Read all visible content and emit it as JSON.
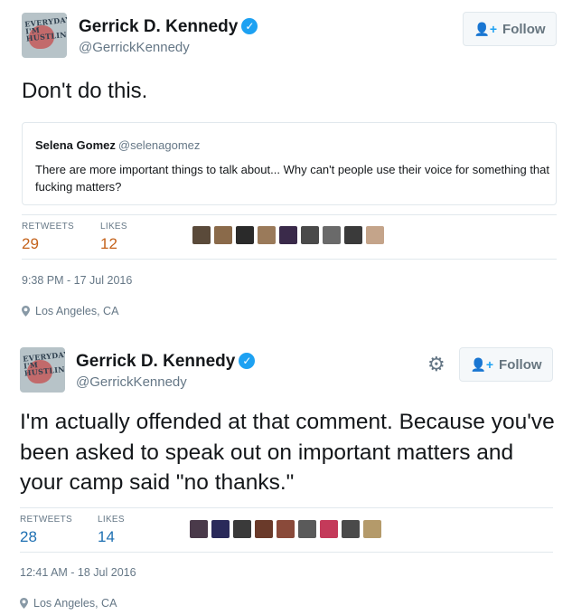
{
  "tweets": [
    {
      "author": {
        "name": "Gerrick D. Kennedy",
        "handle": "@GerrickKennedy",
        "avatar_text": "EVERYDAY I'M HUSTLIN"
      },
      "follow_label": "Follow",
      "text": "Don't do this.",
      "quoted": {
        "name": "Selena Gomez",
        "handle": "@selenagomez",
        "text": "There are more important things to talk about... Why can't people use their voice for something that fucking matters?"
      },
      "stats": {
        "retweets_label": "RETWEETS",
        "retweets": "29",
        "likes_label": "LIKES",
        "likes": "12"
      },
      "liker_colors": [
        "#5a4a3a",
        "#8a6a4a",
        "#2a2a2a",
        "#9a7a5a",
        "#3a2a4a",
        "#4a4a4a",
        "#6a6a6a",
        "#3a3a3a",
        "#c4a48a"
      ],
      "timestamp": "9:38 PM - 17 Jul 2016",
      "location": "Los Angeles, CA"
    },
    {
      "author": {
        "name": "Gerrick D. Kennedy",
        "handle": "@GerrickKennedy",
        "avatar_text": "EVERYDAY I'M HUSTLIN"
      },
      "follow_label": "Follow",
      "text": "I'm actually offended at that comment. Because you've been asked to speak out on important matters and your camp said \"no thanks.\"",
      "stats": {
        "retweets_label": "RETWEETS",
        "retweets": "28",
        "likes_label": "LIKES",
        "likes": "14"
      },
      "liker_colors": [
        "#4a3a4a",
        "#2a2a5a",
        "#3a3a3a",
        "#6a3a2a",
        "#8a4a3a",
        "#5a5a5a",
        "#c43a5a",
        "#4a4a4a",
        "#b49a6a"
      ],
      "timestamp": "12:41 AM - 18 Jul 2016",
      "location": "Los Angeles, CA"
    }
  ],
  "colors": {
    "verified": "#1da1f2",
    "muted": "#657786",
    "divider": "#e1e8ed"
  },
  "icons": {
    "verified": "verified-badge-icon",
    "follow": "add-user-icon",
    "settings": "gear-icon",
    "location": "map-pin-icon"
  }
}
